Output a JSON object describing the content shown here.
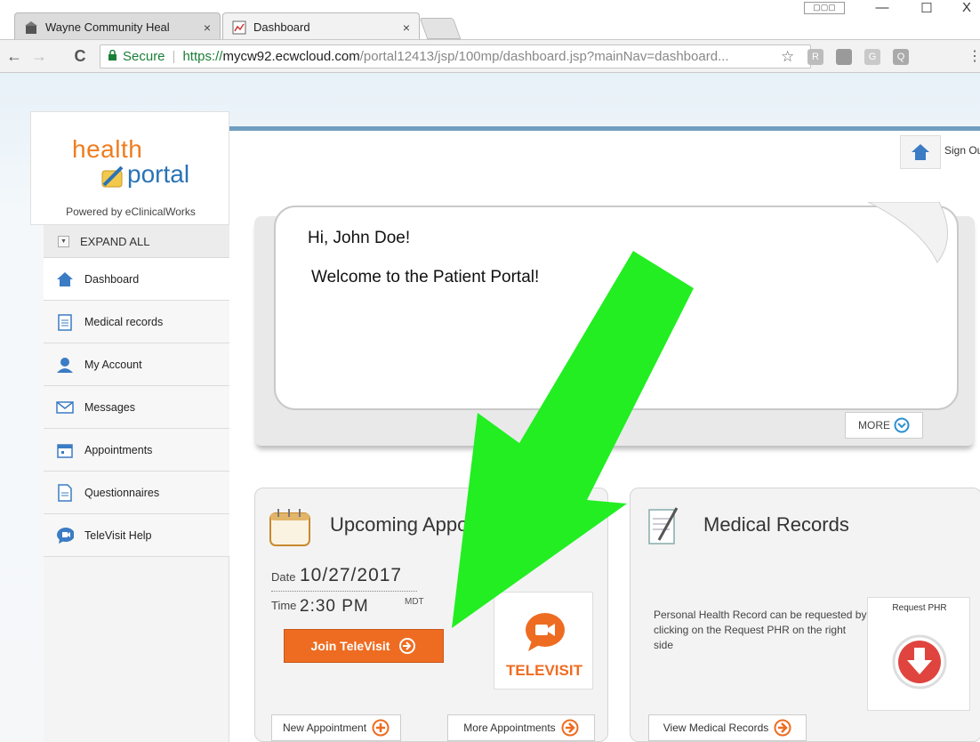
{
  "browser": {
    "tabs": [
      {
        "title": "Wayne Community Heal",
        "close": "×"
      },
      {
        "title": "Dashboard",
        "close": "×"
      }
    ],
    "window_controls": [
      "—",
      "☐",
      "X"
    ],
    "nav": {
      "back": "←",
      "forward": "→",
      "reload": "C"
    },
    "address": {
      "secure_label": "Secure",
      "scheme": "https://",
      "host": "mycw92.ecwcloud.com",
      "path": "/portal12413/jsp/100mp/dashboard.jsp?mainNav=dashboard..."
    },
    "extensions": [
      "R",
      "",
      "G",
      "Q"
    ]
  },
  "logo": {
    "health": "health",
    "portal": "portal",
    "powered_by": "Powered by eClinicalWorks"
  },
  "header": {
    "sign_out": "Sign Out"
  },
  "sidebar": {
    "expand_all": "EXPAND ALL",
    "items": [
      {
        "label": "Dashboard",
        "icon": "home-icon"
      },
      {
        "label": "Medical records",
        "icon": "clipboard-icon"
      },
      {
        "label": "My Account",
        "icon": "user-icon"
      },
      {
        "label": "Messages",
        "icon": "envelope-icon"
      },
      {
        "label": "Appointments",
        "icon": "calendar-icon"
      },
      {
        "label": "Questionnaires",
        "icon": "document-icon"
      },
      {
        "label": "TeleVisit Help",
        "icon": "chat-video-icon"
      }
    ]
  },
  "welcome": {
    "greeting": "Hi, John Doe!",
    "message": "Welcome to the Patient Portal!",
    "more_label": "MORE"
  },
  "appointments": {
    "title": "Upcoming Appointments",
    "date_label": "Date",
    "date": "10/27/2017",
    "time_label": "Time",
    "time": "2:30 PM",
    "timezone": "MDT",
    "join_label": "Join TeleVisit",
    "televisit_label": "TELEVISIT",
    "new_appointment": "New Appointment",
    "more_appointments": "More Appointments"
  },
  "records": {
    "title": "Medical Records",
    "description": "Personal Health Record can be requested by clicking on the Request PHR on the right side",
    "request_phr": "Request PHR",
    "view_records": "View Medical Records"
  },
  "colors": {
    "accent_orange": "#ee6c21",
    "brand_blue": "#2a73b6",
    "arrow_green": "#22ee22"
  }
}
